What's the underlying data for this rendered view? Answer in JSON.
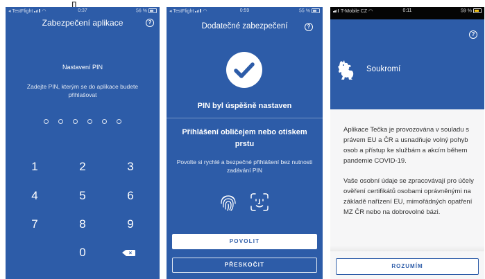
{
  "stray_mark": "п",
  "screen1": {
    "status": {
      "left": "◂ TestFlight",
      "time": "0:37",
      "battery": "56 %"
    },
    "title": "Zabezpečení aplikace",
    "help_icon": "question-circle-icon",
    "pin_heading": "Nastavení PIN",
    "pin_text": "Zadejte PIN, kterým se do aplikace budete přihlašovat",
    "pin_length": 6,
    "keys": [
      "1",
      "2",
      "3",
      "4",
      "5",
      "6",
      "7",
      "8",
      "9",
      "0"
    ],
    "backspace_icon": "backspace-icon"
  },
  "screen2": {
    "status": {
      "left": "◂ TestFlight",
      "time": "0:59",
      "battery": "55 %"
    },
    "title": "Dodatečné zabezpečení",
    "success_icon": "checkmark-circle-icon",
    "pin_success": "PIN byl úspěšně nastaven",
    "biometric_heading": "Přihlášení obličejem nebo otiskem prstu",
    "biometric_text": "Povolte si rychlé a bezpečné přihlášení bez nutnosti zadávání PIN",
    "allow_button": "POVOLIT",
    "skip_button": "PŘESKOČIT"
  },
  "screen3": {
    "status": {
      "left": "T-Mobile CZ",
      "time": "0:11",
      "battery": "59 %"
    },
    "title": "Soukromí",
    "paragraph1": "Aplikace Tečka je provozována v souladu s právem EU a ČR a usnadňuje volný pohyb osob a přístup ke službám a akcím během pandemie COVID-19.",
    "paragraph2": "Vaše osobní údaje se zpracovávají pro účely ověření certifikátů osobami oprávněnými na základě nařízení EU, mimořádných opatření MZ ČR nebo na dobrovolné bázi.",
    "accept_button": "ROZUMÍM"
  },
  "colors": {
    "brand_blue": "#2d5ca8",
    "white": "#ffffff",
    "text_dark": "#333333"
  }
}
